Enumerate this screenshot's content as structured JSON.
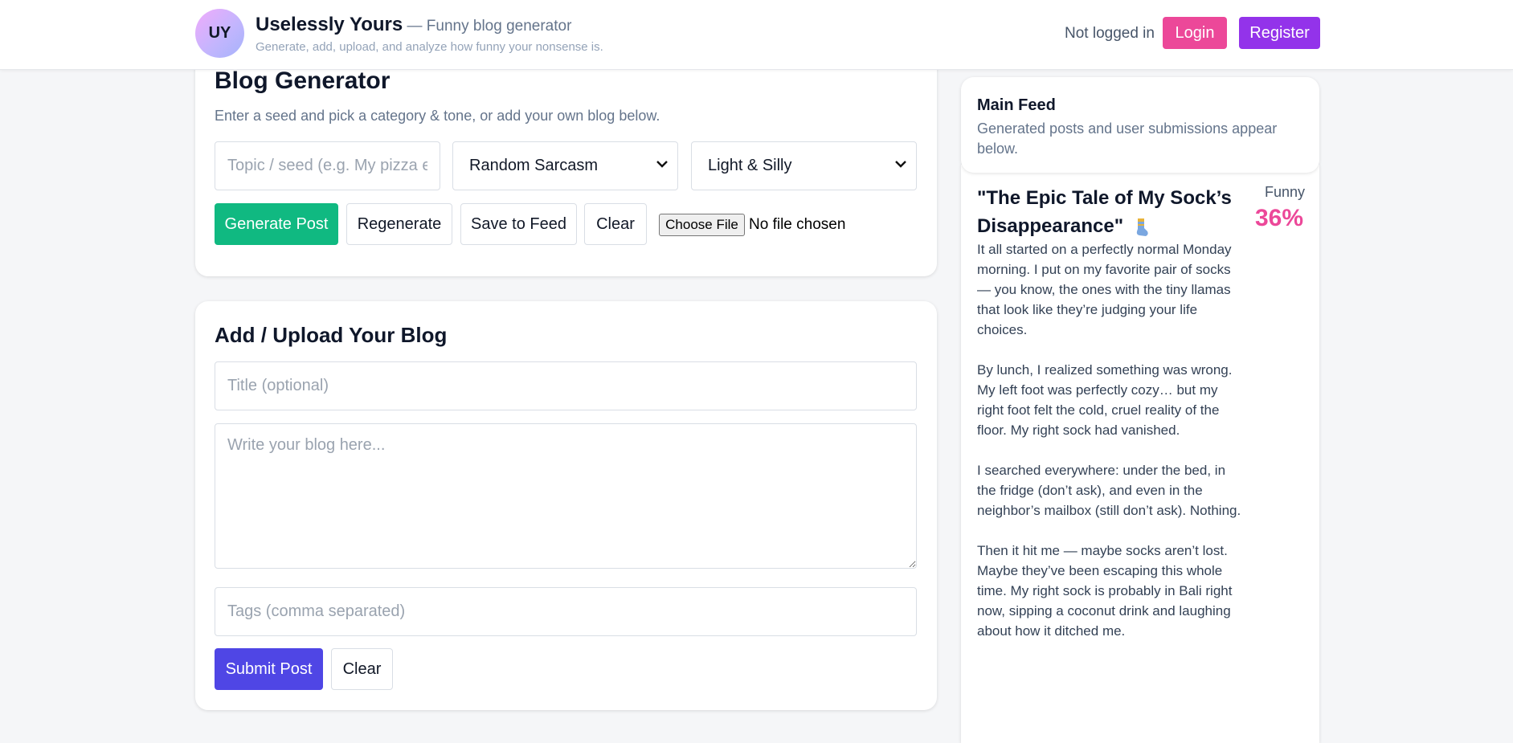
{
  "header": {
    "logo_initials": "UY",
    "brand_name": "Uselessly Yours",
    "brand_separator": " — ",
    "brand_tagline": "Funny blog generator",
    "brand_subtitle": "Generate, add, upload, and analyze how funny your nonsense is.",
    "auth_status": "Not logged in",
    "login_label": "Login",
    "register_label": "Register"
  },
  "generator": {
    "title": "Blog Generator",
    "description": "Enter a seed and pick a category & tone, or add your own blog below.",
    "seed_placeholder": "Topic / seed (e.g. My pizza escaped)",
    "seed_value": "",
    "category_selected": "Random Sarcasm",
    "tone_selected": "Light & Silly",
    "generate_label": "Generate Post",
    "regenerate_label": "Regenerate",
    "save_label": "Save to Feed",
    "clear_label": "Clear",
    "file_button_label": "Choose File",
    "file_status": "No file chosen"
  },
  "add_blog": {
    "title": "Add / Upload Your Blog",
    "title_placeholder": "Title (optional)",
    "body_placeholder": "Write your blog here...",
    "tags_placeholder": "Tags (comma separated)",
    "submit_label": "Submit Post",
    "clear_label": "Clear"
  },
  "feed": {
    "title": "Main Feed",
    "description": "Generated posts and user submissions appear below.",
    "post": {
      "title": "\"The Epic Tale of My Sock’s Disappearance\"",
      "icon": "sock-icon",
      "funny_label": "Funny",
      "funny_score": "36%",
      "paragraphs": [
        "It all started on a perfectly normal Monday morning. I put on my favorite pair of socks — you know, the ones with the tiny llamas that look like they’re judging your life choices.",
        "By lunch, I realized something was wrong. My left foot was perfectly cozy… but my right foot felt the cold, cruel reality of the floor. My right sock had vanished.",
        "I searched everywhere: under the bed, in the fridge (don’t ask), and even in the neighbor’s mailbox (still don’t ask). Nothing.",
        "Then it hit me — maybe socks aren’t lost. Maybe they’ve been escaping this whole time. My right sock is probably in Bali right now, sipping a coconut drink and laughing about how it ditched me."
      ]
    }
  },
  "colors": {
    "accent_pink": "#ec4899",
    "accent_purple": "#9333ea",
    "accent_green": "#10b981",
    "accent_indigo": "#4f46e5"
  }
}
